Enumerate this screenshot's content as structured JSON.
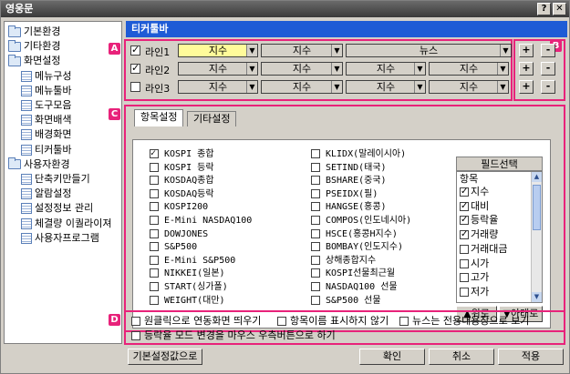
{
  "window": {
    "title": "영웅문"
  },
  "tree": [
    {
      "label": "기본환경",
      "type": "folder",
      "depth": 0
    },
    {
      "label": "기타환경",
      "type": "folder",
      "depth": 0
    },
    {
      "label": "화면설정",
      "type": "folder",
      "depth": 0
    },
    {
      "label": "메뉴구성",
      "type": "doc",
      "depth": 1
    },
    {
      "label": "메뉴툴바",
      "type": "doc",
      "depth": 1
    },
    {
      "label": "도구모음",
      "type": "doc",
      "depth": 1
    },
    {
      "label": "화면배색",
      "type": "doc",
      "depth": 1
    },
    {
      "label": "배경화면",
      "type": "doc",
      "depth": 1
    },
    {
      "label": "티커툴바",
      "type": "doc",
      "depth": 1
    },
    {
      "label": "사용자환경",
      "type": "folder",
      "depth": 0
    },
    {
      "label": "단축키만들기",
      "type": "doc",
      "depth": 1
    },
    {
      "label": "알람설정",
      "type": "doc",
      "depth": 1
    },
    {
      "label": "설정정보 관리",
      "type": "doc",
      "depth": 1
    },
    {
      "label": "체결량 이퀄라이져",
      "type": "doc",
      "depth": 1
    },
    {
      "label": "사용자프로그램",
      "type": "doc",
      "depth": 1
    }
  ],
  "header": {
    "title": "티커툴바"
  },
  "badges": {
    "a": "A",
    "b": "B",
    "c": "C",
    "d": "D"
  },
  "lines": [
    {
      "label": "라인1",
      "checked": true,
      "combos": [
        "지수",
        "지수",
        "뉴스"
      ]
    },
    {
      "label": "라인2",
      "checked": true,
      "combos": [
        "지수",
        "지수",
        "지수",
        "지수"
      ]
    },
    {
      "label": "라인3",
      "checked": false,
      "combos": [
        "지수",
        "지수",
        "지수",
        "지수"
      ]
    }
  ],
  "side_buttons": {
    "plus": "+",
    "minus": "-"
  },
  "tabs": [
    {
      "label": "항목설정"
    },
    {
      "label": "기타설정"
    }
  ],
  "items_left": [
    {
      "label": "KOSPI 종합",
      "checked": true
    },
    {
      "label": "KOSPI 등락",
      "checked": false
    },
    {
      "label": "KOSDAQ종합",
      "checked": false
    },
    {
      "label": "KOSDAQ등락",
      "checked": false
    },
    {
      "label": "KOSPI200",
      "checked": false
    },
    {
      "label": "E-Mini NASDAQ100",
      "checked": false
    },
    {
      "label": "DOWJONES",
      "checked": false
    },
    {
      "label": "S&P500",
      "checked": false
    },
    {
      "label": "E-Mini S&P500",
      "checked": false
    },
    {
      "label": "NIKKEI(일본)",
      "checked": false
    },
    {
      "label": "START(싱가폴)",
      "checked": false
    },
    {
      "label": "WEIGHT(대만)",
      "checked": false
    }
  ],
  "items_right": [
    {
      "label": "KLIDX(말레이시아)",
      "checked": false
    },
    {
      "label": "SETIND(태국)",
      "checked": false
    },
    {
      "label": "BSHARE(중국)",
      "checked": false
    },
    {
      "label": "PSEIDX(필)",
      "checked": false
    },
    {
      "label": "HANGSE(홍콩)",
      "checked": false
    },
    {
      "label": "COMPOS(인도네시아)",
      "checked": false
    },
    {
      "label": "HSCE(홍콩H지수)",
      "checked": false
    },
    {
      "label": "BOMBAY(인도지수)",
      "checked": false
    },
    {
      "label": "상해종합지수",
      "checked": false
    },
    {
      "label": "KOSPI선물최근월",
      "checked": false
    },
    {
      "label": "NASDAQ100 선물",
      "checked": false
    },
    {
      "label": "S&P500 선물",
      "checked": false
    }
  ],
  "field_select": {
    "title": "필드선택",
    "column": "항목",
    "items": [
      {
        "label": "지수",
        "checked": true
      },
      {
        "label": "대비",
        "checked": true
      },
      {
        "label": "등락율",
        "checked": true
      },
      {
        "label": "거래량",
        "checked": true
      },
      {
        "label": "거래대금",
        "checked": false
      },
      {
        "label": "시가",
        "checked": false
      },
      {
        "label": "고가",
        "checked": false
      },
      {
        "label": "저가",
        "checked": false
      }
    ],
    "up": "▲위로",
    "down": "▼아래로"
  },
  "options": [
    {
      "label": "원클릭으로 연동화면 띄우기"
    },
    {
      "label": "항목이름 표시하지 않기"
    },
    {
      "label": "뉴스는 전용내용창으로 보기"
    },
    {
      "label": "등락율 모드 변경을 마우스 우측버튼으로 하기"
    }
  ],
  "footer": {
    "defaults": "기본설정값으로",
    "ok": "확인",
    "cancel": "취소",
    "apply": "적용"
  },
  "colors": {
    "accent": "#1e5bd6",
    "highlight": "#e8227a",
    "selected_combo": "#fffb9a"
  }
}
